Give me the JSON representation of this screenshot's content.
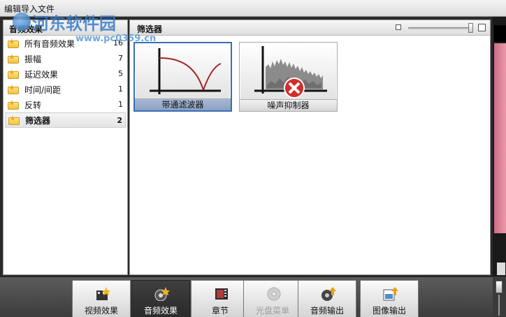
{
  "window": {
    "title": "编辑导入文件"
  },
  "watermark": {
    "text": "河东软件园",
    "url": "www.pc0359.cn"
  },
  "left_panel": {
    "header": "音频效果",
    "categories": [
      {
        "label": "所有音频效果",
        "count": "16"
      },
      {
        "label": "振幅",
        "count": "7"
      },
      {
        "label": "延迟效果",
        "count": "5"
      },
      {
        "label": "时间/间距",
        "count": "1"
      },
      {
        "label": "反转",
        "count": "1"
      },
      {
        "label": "筛选器",
        "count": "2"
      }
    ],
    "selected_index": 5
  },
  "right_panel": {
    "header": "筛选器",
    "tiles": [
      {
        "label": "带通滤波器",
        "icon": "bandpass-curve-icon",
        "selected": true
      },
      {
        "label": "噪声抑制器",
        "icon": "noise-suppressor-icon",
        "selected": false
      }
    ]
  },
  "toolbar": {
    "buttons": [
      {
        "label": "视频效果",
        "icon": "video-effects-icon",
        "state": "normal"
      },
      {
        "label": "音频效果",
        "icon": "audio-effects-icon",
        "state": "active"
      },
      {
        "label": "章节",
        "icon": "chapter-icon",
        "state": "normal"
      },
      {
        "label": "光盘菜单",
        "icon": "disc-menu-icon",
        "state": "disabled"
      },
      {
        "label": "音频输出",
        "icon": "audio-output-icon",
        "state": "normal"
      },
      {
        "label": "图像输出",
        "icon": "image-output-icon",
        "state": "normal"
      }
    ]
  },
  "colors": {
    "selection_blue": "#3a6fb2",
    "curve_red": "#a3232c",
    "error_red": "#d22d2d"
  }
}
